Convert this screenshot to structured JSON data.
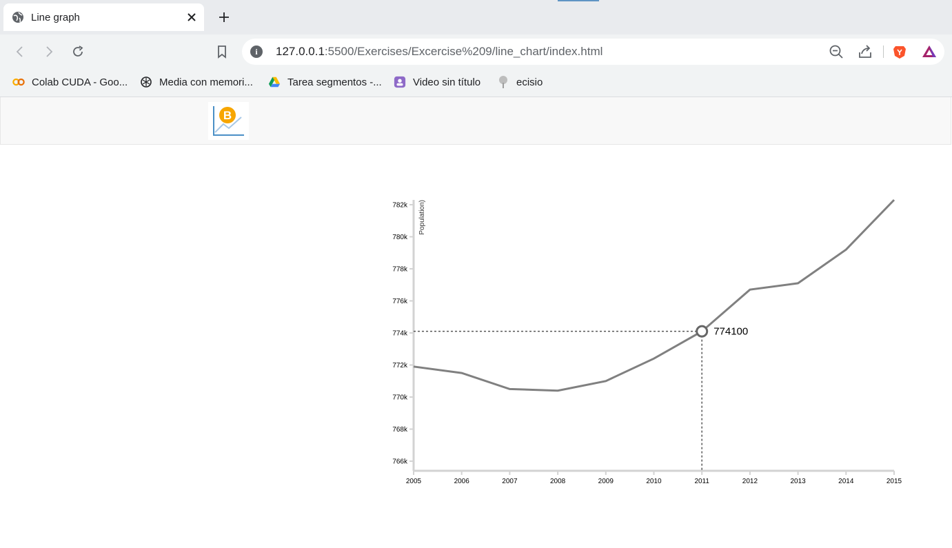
{
  "browser": {
    "tab_title": "Line graph",
    "url_host": "127.0.0.1",
    "url_path": ":5500/Exercises/Excercise%209/line_chart/index.html",
    "bookmarks": [
      {
        "label": "Colab CUDA - Goo...",
        "icon": "colab-icon"
      },
      {
        "label": "Media con memori...",
        "icon": "openai-icon"
      },
      {
        "label": "Tarea segmentos -...",
        "icon": "google-drive-icon"
      },
      {
        "label": "Video sin título",
        "icon": "video-icon"
      },
      {
        "label": "ecisio",
        "icon": "tree-icon"
      }
    ]
  },
  "page": {
    "logo_icon": "bitcoin-chart-logo"
  },
  "chart_data": {
    "type": "line",
    "ylabel": "Population)",
    "x": [
      2005,
      2006,
      2007,
      2008,
      2009,
      2010,
      2011,
      2012,
      2013,
      2014,
      2015
    ],
    "values": [
      771900,
      771500,
      770500,
      770400,
      771000,
      772400,
      774100,
      776700,
      777100,
      779200,
      782300
    ],
    "y_ticks": [
      766000,
      768000,
      770000,
      772000,
      774000,
      776000,
      778000,
      780000,
      782000
    ],
    "y_tick_labels": [
      "766k",
      "768k",
      "770k",
      "772k",
      "774k",
      "776k",
      "778k",
      "780k",
      "782k"
    ],
    "x_tick_labels": [
      "2005",
      "2006",
      "2007",
      "2008",
      "2009",
      "2010",
      "2011",
      "2012",
      "2013",
      "2014",
      "2015"
    ],
    "ylim": [
      765400,
      782300
    ],
    "xlim": [
      2005,
      2015
    ],
    "line_color": "#808080",
    "axis_color": "#d3d3d3",
    "grid": false,
    "hover": {
      "x": 2011,
      "value": 774100,
      "label": "774100"
    }
  }
}
